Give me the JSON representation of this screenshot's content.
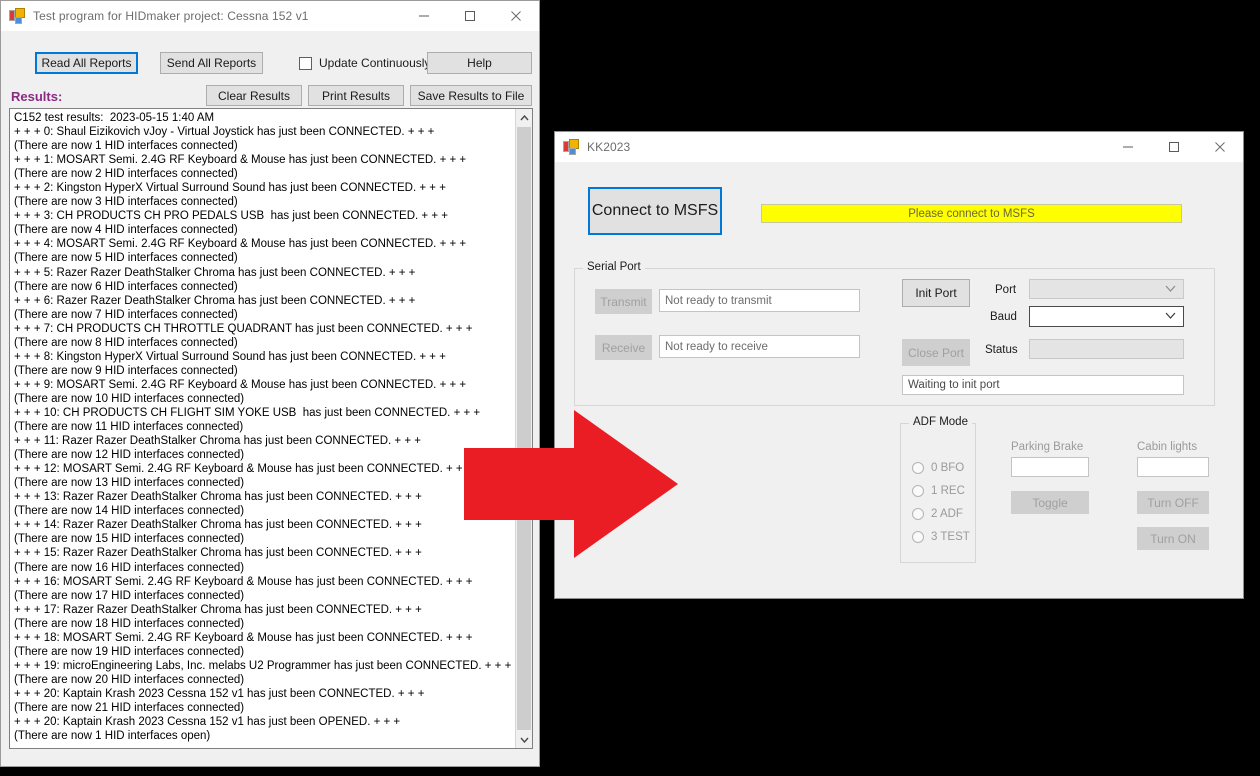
{
  "hidmaker_window": {
    "title": "Test program for HIDmaker project: Cessna 152 v1",
    "icon": "app-icon",
    "window_buttons": {
      "minimize": "minimize-icon",
      "maximize": "maximize-icon",
      "close": "close-icon"
    },
    "toolbar": {
      "read_all_reports": "Read All Reports",
      "send_all_reports": "Send All Reports",
      "update_continuously": "Update Continuously",
      "update_continuously_checked": false,
      "help": "Help",
      "clear_results": "Clear Results",
      "print_results": "Print Results",
      "save_results_to_file": "Save Results to File"
    },
    "results_label": "Results:",
    "results_label_color": "#8b2a83",
    "log": [
      "C152 test results:  2023-05-15 1:40 AM",
      "+ + + 0: Shaul Eizikovich vJoy - Virtual Joystick has just been CONNECTED. + + +",
      "(There are now 1 HID interfaces connected)",
      "+ + + 1: MOSART Semi. 2.4G RF Keyboard & Mouse has just been CONNECTED. + + +",
      "(There are now 2 HID interfaces connected)",
      "+ + + 2: Kingston HyperX Virtual Surround Sound has just been CONNECTED. + + +",
      "(There are now 3 HID interfaces connected)",
      "+ + + 3: CH PRODUCTS CH PRO PEDALS USB  has just been CONNECTED. + + +",
      "(There are now 4 HID interfaces connected)",
      "+ + + 4: MOSART Semi. 2.4G RF Keyboard & Mouse has just been CONNECTED. + + +",
      "(There are now 5 HID interfaces connected)",
      "+ + + 5: Razer Razer DeathStalker Chroma has just been CONNECTED. + + +",
      "(There are now 6 HID interfaces connected)",
      "+ + + 6: Razer Razer DeathStalker Chroma has just been CONNECTED. + + +",
      "(There are now 7 HID interfaces connected)",
      "+ + + 7: CH PRODUCTS CH THROTTLE QUADRANT has just been CONNECTED. + + +",
      "(There are now 8 HID interfaces connected)",
      "+ + + 8: Kingston HyperX Virtual Surround Sound has just been CONNECTED. + + +",
      "(There are now 9 HID interfaces connected)",
      "+ + + 9: MOSART Semi. 2.4G RF Keyboard & Mouse has just been CONNECTED. + + +",
      "(There are now 10 HID interfaces connected)",
      "+ + + 10: CH PRODUCTS CH FLIGHT SIM YOKE USB  has just been CONNECTED. + + +",
      "(There are now 11 HID interfaces connected)",
      "+ + + 11: Razer Razer DeathStalker Chroma has just been CONNECTED. + + +",
      "(There are now 12 HID interfaces connected)",
      "+ + + 12: MOSART Semi. 2.4G RF Keyboard & Mouse has just been CONNECTED. + + +",
      "(There are now 13 HID interfaces connected)",
      "+ + + 13: Razer Razer DeathStalker Chroma has just been CONNECTED. + + +",
      "(There are now 14 HID interfaces connected)",
      "+ + + 14: Razer Razer DeathStalker Chroma has just been CONNECTED. + + +",
      "(There are now 15 HID interfaces connected)",
      "+ + + 15: Razer Razer DeathStalker Chroma has just been CONNECTED. + + +",
      "(There are now 16 HID interfaces connected)",
      "+ + + 16: MOSART Semi. 2.4G RF Keyboard & Mouse has just been CONNECTED. + + +",
      "(There are now 17 HID interfaces connected)",
      "+ + + 17: Razer Razer DeathStalker Chroma has just been CONNECTED. + + +",
      "(There are now 18 HID interfaces connected)",
      "+ + + 18: MOSART Semi. 2.4G RF Keyboard & Mouse has just been CONNECTED. + + +",
      "(There are now 19 HID interfaces connected)",
      "+ + + 19: microEngineering Labs, Inc. melabs U2 Programmer has just been CONNECTED. + + +",
      "(There are now 20 HID interfaces connected)",
      "+ + + 20: Kaptain Krash 2023 Cessna 152 v1 has just been CONNECTED. + + +",
      "(There are now 21 HID interfaces connected)",
      "+ + + 20: Kaptain Krash 2023 Cessna 152 v1 has just been OPENED. + + +",
      "(There are now 1 HID interfaces open)"
    ],
    "scrollbar": {
      "up_arrow": "chevron-up-icon",
      "down_arrow": "chevron-down-icon"
    }
  },
  "kk2023_window": {
    "title": "KK2023",
    "icon": "app-icon",
    "window_buttons": {
      "minimize": "minimize-icon",
      "maximize": "maximize-icon",
      "close": "close-icon"
    },
    "connect_button": "Connect to MSFS",
    "status_banner": "Please connect to MSFS",
    "status_banner_color": "#ffff00",
    "serial_port": {
      "group_title": "Serial Port",
      "transmit_button": "Transmit",
      "transmit_status": "Not ready to transmit",
      "receive_button": "Receive",
      "receive_status": "Not ready to receive",
      "init_port_button": "Init Port",
      "close_port_button": "Close Port",
      "port_label": "Port",
      "port_value": "",
      "baud_label": "Baud",
      "baud_value": "",
      "status_label": "Status",
      "status_value": "",
      "init_status": "Waiting to init port",
      "chevron": "chevron-down-icon"
    },
    "adf_mode": {
      "group_title": "ADF Mode",
      "options": [
        {
          "label": "0 BFO",
          "selected": false
        },
        {
          "label": "1 REC",
          "selected": false
        },
        {
          "label": "2 ADF",
          "selected": false
        },
        {
          "label": "3 TEST",
          "selected": false
        }
      ]
    },
    "parking_brake": {
      "label": "Parking Brake",
      "value": "",
      "toggle_button": "Toggle"
    },
    "cabin_lights": {
      "label": "Cabin lights",
      "value": "",
      "turn_off_button": "Turn OFF",
      "turn_on_button": "Turn ON"
    }
  },
  "annotation": {
    "arrow": "right-arrow-annotation",
    "color": "#ea1d25"
  }
}
